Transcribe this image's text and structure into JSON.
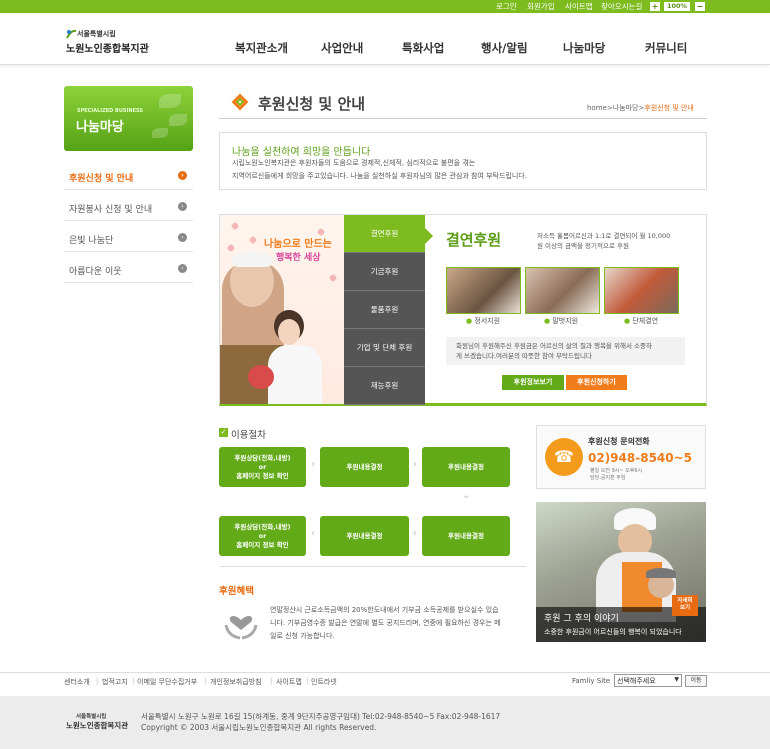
{
  "topbar": {
    "links": [
      "로그인",
      "회원가입",
      "사이트맵",
      "찾아오시는길"
    ],
    "zoom_in": "+",
    "zoom": "100%",
    "zoom_out": "−"
  },
  "logo": {
    "city": "서울특별시립",
    "name": "노원노인종합복지관"
  },
  "gnb": [
    "복지관소개",
    "사업안내",
    "특화사업",
    "행사/알림",
    "나눔마당",
    "커뮤니티"
  ],
  "side": {
    "banner_en": "SPECIALIZED BUSINESS",
    "banner_title": "나눔마당",
    "items": [
      {
        "label": "후원신청 및 안내",
        "active": true
      },
      {
        "label": "자원봉사 신청 및 안내"
      },
      {
        "label": "은빛 나눔단"
      },
      {
        "label": "아름다운 이웃"
      }
    ],
    "arrow": "›"
  },
  "page": {
    "title": "후원신청 및 안내",
    "breadcrumb": {
      "path": "home>나눔마당>",
      "current": "후원신청 및 안내"
    }
  },
  "intro": {
    "heading": "나눔을 실천하여 희망을 만듭니다",
    "lines": [
      "시립노원노인복지관은 후원자들의 도움으로 경제적,신체적, 심리적으로 불편을 겪는",
      "지역어르신들에게 희망을 주고있습니다. 나눔을 실천하실 후원자님의 많은 관심과 참여 부탁드립니다."
    ]
  },
  "promo": {
    "slogan1": "나눔으로 만드는",
    "slogan2": "행복한 세상",
    "tabs": [
      "결연후원",
      "기금후원",
      "물품후원",
      "기업 및 단체 후원",
      "재능후원"
    ],
    "title": "결연후원",
    "desc": [
      "저소득 홀몸어르신과 1:1로 결연되어 월 10,000",
      "원 이상의 금액을 정기적으로 후원"
    ],
    "photo_captions": [
      "정서지원",
      "말벗지원",
      "단체결연"
    ],
    "bullet": "●",
    "message": [
      "회원님이 후원해주신 후원금은 어르신의 삶의 질과 행복을 위해서 소중하",
      "게 쓰겠습니다.여러분의 따뜻한 참여 부탁드립니다"
    ],
    "btn_info": "후원정보보기",
    "btn_apply": "후원신청하기"
  },
  "process": {
    "heading": "이용절차",
    "check": "✓",
    "row1": [
      [
        "후원상담(전화,내방)",
        "or",
        "홈페이지 정보 확인"
      ],
      [
        "후원내용결정"
      ],
      [
        "후원내용결정"
      ]
    ],
    "row2": [
      [
        "후원상담(전화,내방)",
        "or",
        "홈페이지 정보 확인"
      ],
      [
        "후원내용결정"
      ],
      [
        "후원내용결정"
      ]
    ],
    "chev_r": "›",
    "chev_l": "‹",
    "chev_d": "⌄"
  },
  "benefit": {
    "heading": "후원혜택",
    "lines": [
      "연말정산시 근로소득금액의 20%한도내에서 기부금 소득공제를 받으실수 있습",
      "니다. 기부금영수증 발급은 연말에 별도 공지드리며, 연중에 필요하신 경우는 메",
      "일로 신청 가능합니다."
    ]
  },
  "call": {
    "title": "후원신청 문의전화",
    "number": "02)948-8540~5",
    "hours": [
      "평일 오전 9시~ 오후6시",
      "담당:공지훈 주임"
    ],
    "icon": "☎"
  },
  "story": {
    "title": "후원 그 후의 이야기",
    "subtitle": "소중한 후원금이 어르신들의 행복이 되었습니다",
    "more": [
      "자세히",
      "보기"
    ]
  },
  "footer": {
    "links": [
      "센터소개",
      "법적고지",
      "이메일 무단수집거부",
      "개인정보취급방침",
      "사이트맵",
      "인트라넷"
    ],
    "sep": "|",
    "family_label": "Famliy Site",
    "family_select": "선택해주세요",
    "go": "이동",
    "logo_city": "서울특별시립",
    "logo_name": "노원노인종합복지관",
    "address": "서울특별시 노원구 노원로 16길 15(하계동, 중계 9단지주공영구임대) Tel:02-948-8540~5 Fax:02-948-1617",
    "copyright": "Copyright © 2003 서울시립노원노인종합복지관 All rights Reserved."
  },
  "colors": {
    "green": "#7dbb1f",
    "orange": "#e86b12",
    "dark_tab": "#555555"
  }
}
